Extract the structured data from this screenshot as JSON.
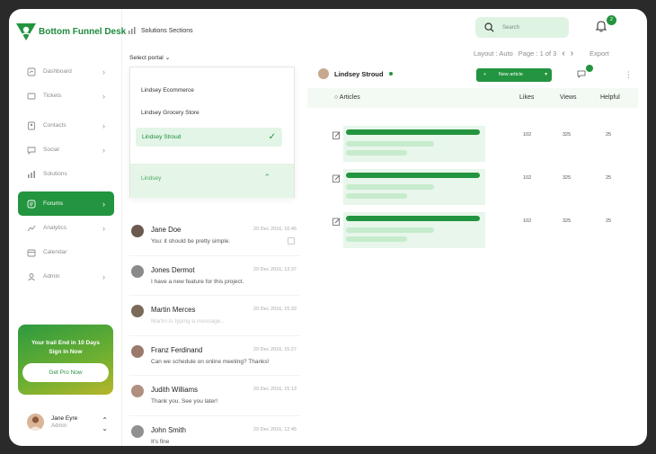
{
  "brand": {
    "name": "Bottom Funnel Desk"
  },
  "sidebar": {
    "items": [
      {
        "label": "Dashboard",
        "icon": "chart-icon",
        "chevron": true,
        "active": false
      },
      {
        "label": "Tickets",
        "icon": "ticket-icon",
        "chevron": true,
        "active": false
      },
      {
        "label": "Contacts",
        "icon": "contacts-icon",
        "chevron": true,
        "active": false
      },
      {
        "label": "Social",
        "icon": "social-icon",
        "chevron": true,
        "active": false
      },
      {
        "label": "Solutions",
        "icon": "solutions-icon",
        "chevron": false,
        "active": false
      },
      {
        "label": "Forums",
        "icon": "forums-icon",
        "chevron": true,
        "active": true
      },
      {
        "label": "Analytics",
        "icon": "analytics-icon",
        "chevron": true,
        "active": false
      },
      {
        "label": "Calendar",
        "icon": "calendar-icon",
        "chevron": false,
        "active": false
      },
      {
        "label": "Admin",
        "icon": "admin-icon",
        "chevron": true,
        "active": false
      }
    ],
    "promo": {
      "line1": "Your trail End in 10 Days",
      "line2": "Sign In Now",
      "button": "Get Pro Now"
    },
    "user": {
      "name": "Jane Eyre",
      "role": "Admin"
    }
  },
  "header": {
    "breadcrumb": "Solutions Sections",
    "search_placeholder": "Search",
    "notification_count": "2",
    "layout": "Layout : Auto",
    "page": "Page : 1 of 3",
    "export": "Export"
  },
  "portal": {
    "label": "Select portal",
    "options": [
      "Lindsey Ecommerce",
      "Lindsey Grocery Store",
      "Lindsey Stroud"
    ],
    "selected": "Lindsey Stroud",
    "search_value": "Lindsey"
  },
  "conversations": [
    {
      "name": "Jane Doe",
      "time": "29 Dec 2016, 16:45",
      "message": "You: it should be pretty simple.",
      "faded": false,
      "avatar": "#6b5a50"
    },
    {
      "name": "Jones Dermot",
      "time": "29 Dec 2016, 13:37",
      "message": "I have a new feature for this project.",
      "faded": false,
      "avatar": "#8a8a8a"
    },
    {
      "name": "Martin Merces",
      "time": "29 Dec 2016, 15:33",
      "message": "Martin is typing a message...",
      "faded": true,
      "avatar": "#7a6a5a"
    },
    {
      "name": "Franz Ferdinand",
      "time": "29 Dec 2016, 15:27",
      "message": "Can we schedule on online meeting? Thanks!",
      "faded": false,
      "avatar": "#9a7a6a"
    },
    {
      "name": "Judith Williams",
      "time": "29 Dec 2016, 15:13",
      "message": "Thank you. See you later!",
      "faded": false,
      "avatar": "#b09080"
    },
    {
      "name": "John Smith",
      "time": "29 Dec 2016, 12:45",
      "message": "It's fine",
      "faded": false,
      "avatar": "#909090"
    }
  ],
  "articles_panel": {
    "owner": "Lindsey Stroud",
    "new_button": "New article",
    "columns": {
      "articles": "Articles",
      "likes": "Likes",
      "views": "Views",
      "helpful": "Helpful"
    },
    "rows": [
      {
        "likes": "102",
        "views": "325",
        "helpful": "25"
      },
      {
        "likes": "102",
        "views": "325",
        "helpful": "25"
      },
      {
        "likes": "102",
        "views": "325",
        "helpful": "25"
      }
    ]
  }
}
